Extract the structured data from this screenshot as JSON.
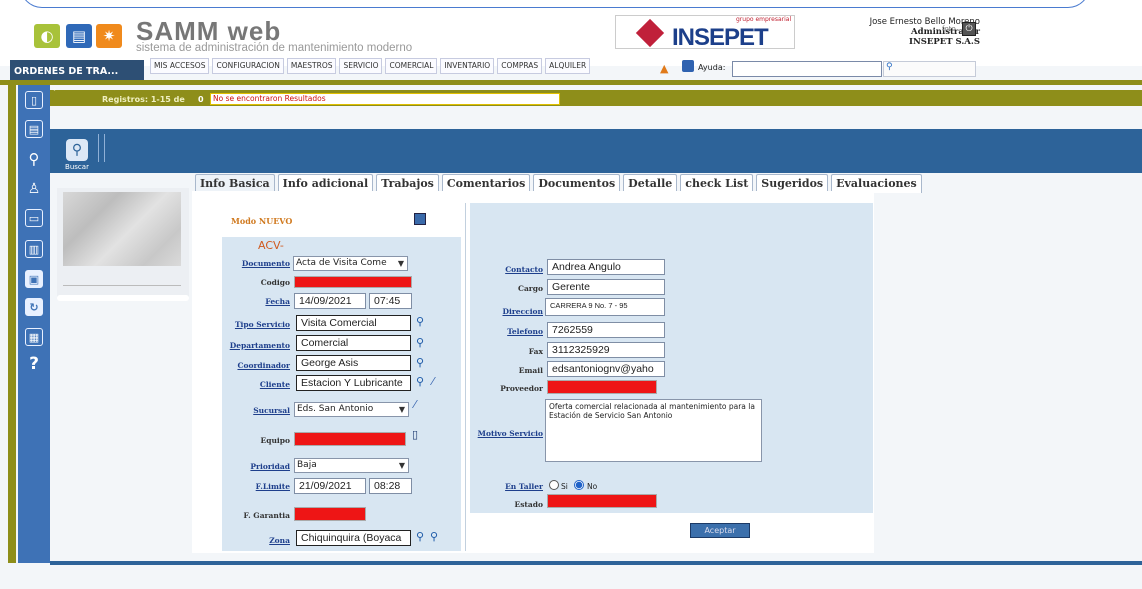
{
  "header": {
    "app_title": "SAMM web",
    "app_subtitle": "sistema de administración de mantenimiento moderno",
    "client_logo_text": "INSEPET",
    "client_logo_tag": "grupo empresarial",
    "user_name": "Jose Ernesto Bello Moreno",
    "user_role": "Administrador",
    "user_company": "INSEPET S.A.S",
    "user_photo_alt": "foto"
  },
  "module_tab": "ORDENES DE TRA...",
  "menu": [
    "MIS ACCESOS",
    "CONFIGURACION",
    "MAESTROS",
    "SERVICIO",
    "COMERCIAL",
    "INVENTARIO",
    "COMPRAS",
    "ALQUILER"
  ],
  "help": {
    "label": "Ayuda:",
    "value": ""
  },
  "status": {
    "registros_label": "Registros: 1-15 de",
    "registros_count": "0",
    "message": "No se encontraron Resultados"
  },
  "toolbar": {
    "search_label": "Buscar"
  },
  "tabs": [
    "Info Basica",
    "Info adicional",
    "Trabajos",
    "Comentarios",
    "Documentos",
    "Detalle",
    "check List",
    "Sugeridos",
    "Evaluaciones"
  ],
  "form": {
    "mode": "Modo NUEVO",
    "prefix": "ACV-",
    "documento_label": "Documento",
    "documento": "Acta de Visita Come",
    "codigo_label": "Codigo",
    "fecha_label": "Fecha",
    "fecha_date": "14/09/2021",
    "fecha_time": "07:45",
    "tipo_servicio_label": "Tipo Servicio",
    "tipo_servicio": "Visita Comercial",
    "departamento_label": "Departamento",
    "departamento": "Comercial",
    "coordinador_label": "Coordinador",
    "coordinador": "George Asis",
    "cliente_label": "Cliente",
    "cliente": "Estacion Y Lubricante",
    "sucursal_label": "Sucursal",
    "sucursal": "Eds. San Antonio",
    "equipo_label": "Equipo",
    "prioridad_label": "Prioridad",
    "prioridad": "Baja",
    "flimite_label": "F.Limite",
    "flimite_date": "21/09/2021",
    "flimite_time": "08:28",
    "fgarantia_label": "F. Garantia",
    "zona_label": "Zona",
    "zona": "Chiquinquira (Boyaca",
    "contacto_label": "Contacto",
    "contacto": "Andrea Angulo",
    "cargo_label": "Cargo",
    "cargo": "Gerente",
    "direccion_label": "Direccion",
    "direccion": "CARRERA 9 No. 7 - 95",
    "telefono_label": "Telefono",
    "telefono": "7262559",
    "fax_label": "Fax",
    "fax": "3112325929",
    "email_label": "Email",
    "email": "edsantoniognv@yaho",
    "proveedor_label": "Proveedor",
    "motivo_label": "Motivo Servicio",
    "motivo": "Oferta comercial relacionada al mantenimiento para la Estación de Servicio San Antonio",
    "en_taller_label": "En Taller",
    "si_label": "Si",
    "no_label": "No",
    "estado_label": "Estado",
    "aceptar": "Aceptar"
  }
}
